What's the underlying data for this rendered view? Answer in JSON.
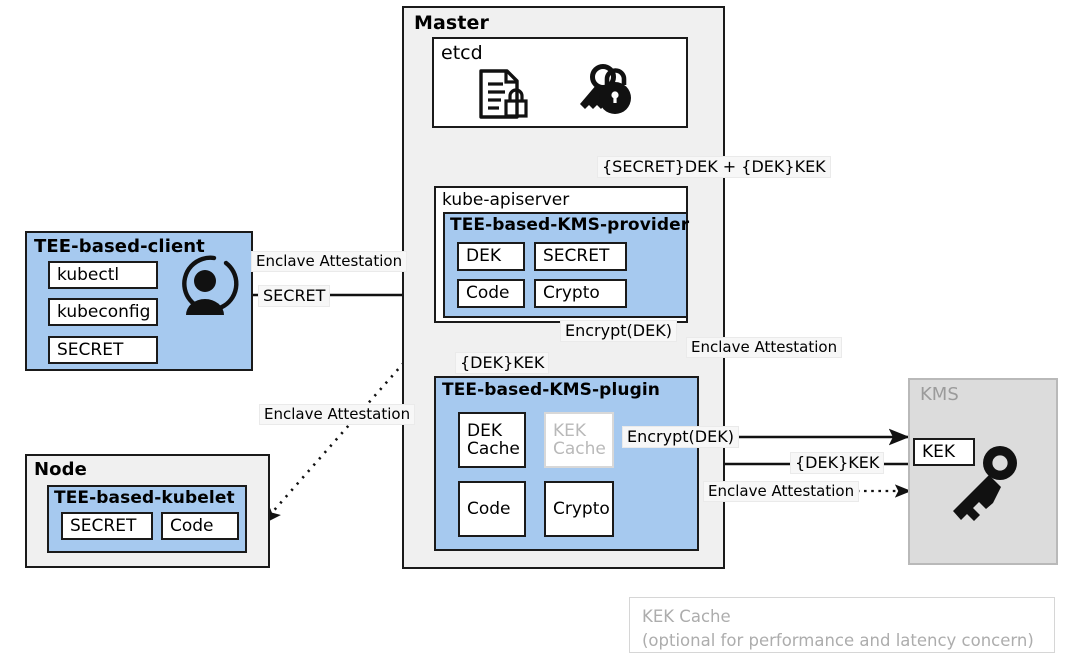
{
  "diagram": {
    "title_hidden": "TEE-based Kubernetes secret encryption with KMS",
    "colors": {
      "enclave_blue": "#a6c9ef",
      "panel_gray": "#f0f0f0",
      "kms_gray": "#dcdcdc",
      "muted_text": "#b0b0b0",
      "stroke": "#1a1a1a"
    }
  },
  "master": {
    "label": "Master",
    "etcd": {
      "label": "etcd",
      "icons": [
        "document-lock-icon",
        "key-lock-icon"
      ]
    },
    "kube_apiserver": {
      "label": "kube-apiserver",
      "kms_provider": {
        "label": "TEE-based-KMS-provider",
        "cells": [
          "DEK",
          "SECRET",
          "Code",
          "Crypto"
        ]
      }
    },
    "kms_plugin": {
      "label": "TEE-based-KMS-plugin",
      "cells": [
        "DEK\nCache",
        "KEK\nCache",
        "Code",
        "Crypto"
      ],
      "muted_cell_index": 1
    }
  },
  "client": {
    "label": "TEE-based-client",
    "items": [
      "kubectl",
      "kubeconfig",
      "SECRET"
    ],
    "avatar_icon": "user-avatar-icon"
  },
  "node": {
    "label": "Node",
    "kubelet": {
      "label": "TEE-based-kubelet",
      "cells": [
        "SECRET",
        "Code"
      ]
    }
  },
  "kms": {
    "label": "KMS",
    "key_cell": "KEK",
    "icon": "key-icon"
  },
  "edge_labels": {
    "secret_dek_kek": "{SECRET}DEK + {DEK}KEK",
    "attestation_client": "Enclave Attestation",
    "secret": "SECRET",
    "encrypt_dek_provider": "Encrypt(DEK)",
    "dek_kek_up": "{DEK}KEK",
    "attestation_plugin": "Enclave Attestation",
    "attestation_node": "Enclave Attestation",
    "encrypt_dek_kms": "Encrypt(DEK)",
    "dek_kek_back": "{DEK}KEK",
    "attestation_kms": "Enclave Attestation"
  },
  "legend": {
    "text": "KEK Cache\n(optional for performance and latency concern)"
  }
}
